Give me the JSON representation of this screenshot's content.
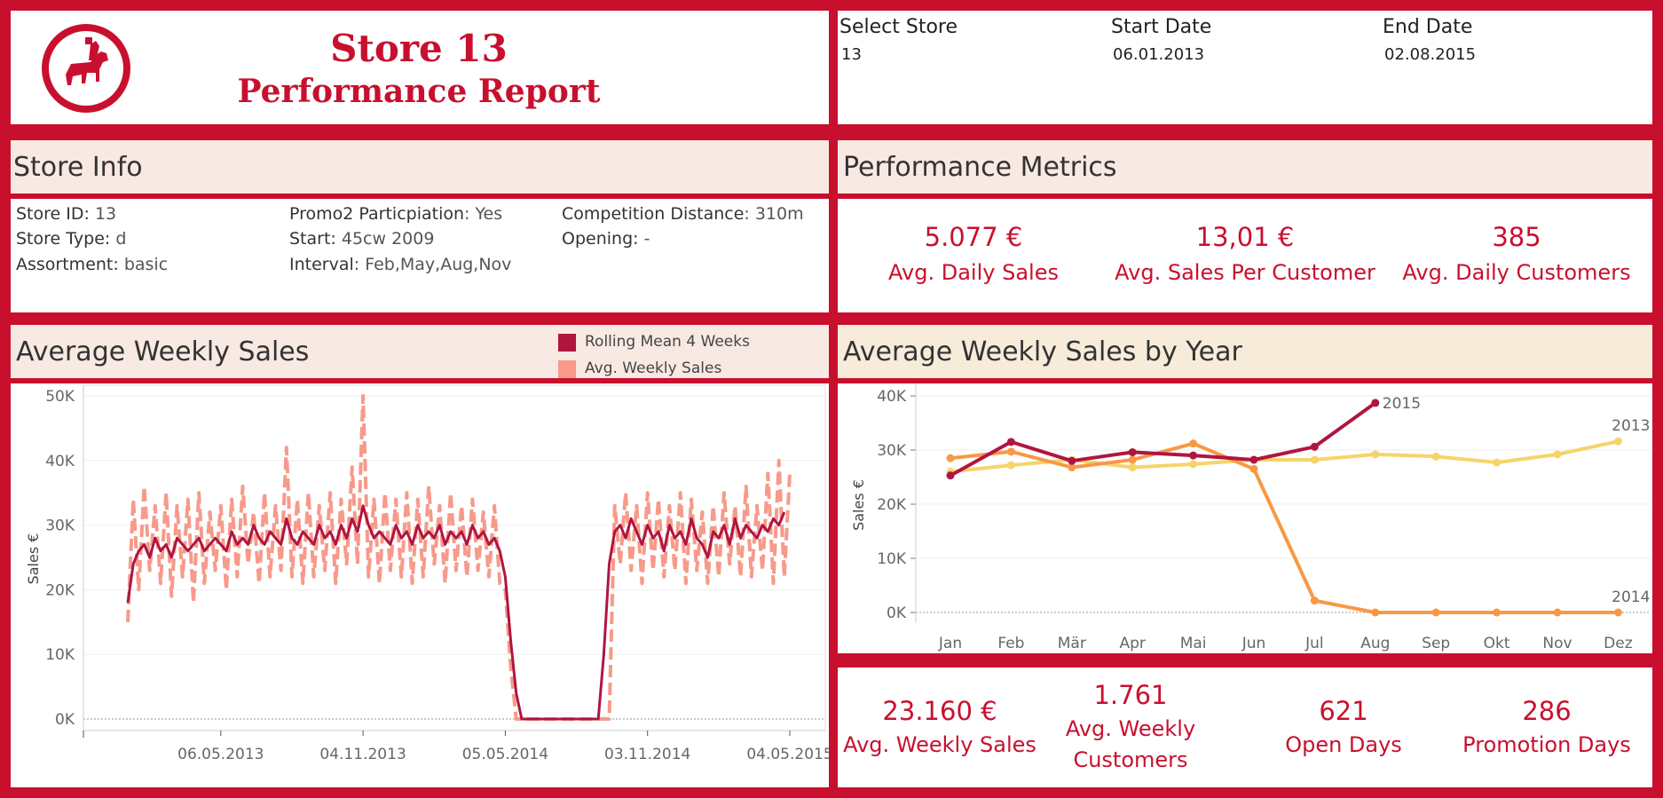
{
  "header": {
    "title_line1": "Store 13",
    "title_line2": "Performance Report",
    "logo": "rider-horse-logo"
  },
  "filters": {
    "store_label": "Select Store",
    "store_value": "13",
    "start_label": "Start Date",
    "start_value": "06.01.2013",
    "end_label": "End Date",
    "end_value": "02.08.2015"
  },
  "store_info": {
    "title": "Store Info",
    "store_id_label": "Store ID:",
    "store_id": "13",
    "store_type_label": "Store Type:",
    "store_type": "d",
    "assortment_label": "Assortment:",
    "assortment": "basic",
    "promo2_label": "Promo2 Particpiation",
    "promo2": ": Yes",
    "start_label": "Start:",
    "start": "45cw 2009",
    "interval_label": "Interval",
    "interval": ": Feb,May,Aug,Nov",
    "competition_label": "Competition Distance",
    "competition": ": 310m",
    "opening_label": "Opening:",
    "opening": "-"
  },
  "metrics": {
    "title": "Performance Metrics",
    "items": [
      {
        "value": "5.077 €",
        "label": "Avg. Daily Sales"
      },
      {
        "value": "13,01 €",
        "label": "Avg. Sales Per Customer"
      },
      {
        "value": "385",
        "label": "Avg. Daily Customers"
      }
    ]
  },
  "bottom_kpis": {
    "items": [
      {
        "value": "23.160 €",
        "label": "Avg. Weekly Sales"
      },
      {
        "value": "1.761",
        "label": "Avg. Weekly Customers"
      },
      {
        "value": "621",
        "label": "Open Days"
      },
      {
        "value": "286",
        "label": "Promotion Days"
      }
    ]
  },
  "colors": {
    "brand": "#c8102e",
    "rolling": "#b01540",
    "weekly": "#f79a8a",
    "y2013": "#f5d46a",
    "y2014": "#f89845",
    "y2015": "#b01540"
  },
  "chart_data": [
    {
      "type": "line",
      "title": "Average Weekly Sales",
      "ylabel": "Sales €",
      "xlabel": "",
      "ylim": [
        0,
        50000
      ],
      "yticks": [
        0,
        10000,
        20000,
        30000,
        40000,
        50000
      ],
      "ytick_labels": [
        "0K",
        "10K",
        "20K",
        "30K",
        "40K",
        "50K"
      ],
      "xtick_labels": [
        "06.05.2013",
        "04.11.2013",
        "05.05.2014",
        "03.11.2014",
        "04.05.2015"
      ],
      "xtick_positions_week": [
        17,
        43,
        69,
        95,
        121
      ],
      "legend": [
        "Rolling Mean 4 Weeks",
        "Avg. Weekly Sales"
      ],
      "legend_position": "top-right",
      "series": [
        {
          "name": "Avg. Weekly Sales",
          "style": "dashed",
          "values": [
            15000,
            34000,
            20000,
            36000,
            23000,
            33000,
            21000,
            35000,
            19000,
            33000,
            22000,
            34000,
            18000,
            35000,
            21000,
            32000,
            23000,
            33000,
            20000,
            34000,
            22000,
            36000,
            24000,
            32000,
            21000,
            35000,
            22000,
            33000,
            23000,
            42000,
            22000,
            34000,
            21000,
            35000,
            22000,
            33000,
            23000,
            35000,
            21000,
            34000,
            24000,
            39000,
            24000,
            50000,
            22000,
            34000,
            21000,
            35000,
            23000,
            34000,
            22000,
            35000,
            21000,
            34000,
            22000,
            36000,
            24000,
            33000,
            21000,
            35000,
            23000,
            33000,
            22000,
            34000,
            23000,
            32000,
            22000,
            33000,
            21000,
            20000,
            8000,
            0,
            0,
            0,
            0,
            0,
            0,
            0,
            0,
            0,
            0,
            0,
            0,
            0,
            0,
            0,
            0,
            0,
            0,
            33000,
            24000,
            35000,
            23000,
            33000,
            21000,
            35000,
            23000,
            34000,
            22000,
            33000,
            23000,
            35000,
            21000,
            34000,
            23000,
            32000,
            21000,
            33000,
            22000,
            35000,
            24000,
            33000,
            22000,
            36000,
            22000,
            33000,
            23000,
            38000,
            21000,
            40000,
            22000,
            38000
          ]
        },
        {
          "name": "Rolling Mean 4 Weeks",
          "style": "solid",
          "values": [
            18000,
            24000,
            26000,
            27000,
            25000,
            28000,
            26000,
            27000,
            25000,
            28000,
            27000,
            26000,
            27000,
            28000,
            26000,
            27000,
            28000,
            27000,
            26000,
            29000,
            27000,
            28000,
            27000,
            30000,
            28000,
            27000,
            29000,
            28000,
            27000,
            31000,
            28000,
            27000,
            29000,
            28000,
            27000,
            30000,
            28000,
            29000,
            27000,
            30000,
            28000,
            31000,
            29000,
            33000,
            30000,
            28000,
            29000,
            28000,
            27000,
            30000,
            28000,
            29000,
            27000,
            30000,
            28000,
            29000,
            28000,
            30000,
            27000,
            29000,
            28000,
            29000,
            27000,
            30000,
            28000,
            29000,
            27000,
            28000,
            26000,
            22000,
            12000,
            4000,
            0,
            0,
            0,
            0,
            0,
            0,
            0,
            0,
            0,
            0,
            0,
            0,
            0,
            0,
            0,
            10000,
            24000,
            29000,
            30000,
            28000,
            31000,
            29000,
            27000,
            30000,
            28000,
            29000,
            26000,
            30000,
            28000,
            29000,
            27000,
            31000,
            28000,
            27000,
            25000,
            29000,
            28000,
            30000,
            27000,
            31000,
            28000,
            30000,
            29000,
            28000,
            30000,
            29000,
            31000,
            30000,
            32000
          ]
        }
      ]
    },
    {
      "type": "line",
      "title": "Average Weekly Sales by Year",
      "ylabel": "Sales €",
      "ylim": [
        0,
        40000
      ],
      "yticks": [
        0,
        10000,
        20000,
        30000,
        40000
      ],
      "ytick_labels": [
        "0K",
        "10K",
        "20K",
        "30K",
        "40K"
      ],
      "categories": [
        "Jan",
        "Feb",
        "Mär",
        "Apr",
        "Mai",
        "Jun",
        "Jul",
        "Aug",
        "Sep",
        "Okt",
        "Nov",
        "Dez"
      ],
      "series": [
        {
          "name": "2013",
          "values": [
            26000,
            27200,
            28200,
            26800,
            27400,
            28200,
            28200,
            29200,
            28800,
            27700,
            29200,
            31600
          ]
        },
        {
          "name": "2014",
          "values": [
            28500,
            29700,
            26800,
            28200,
            31200,
            26500,
            2200,
            0,
            0,
            0,
            0,
            0
          ]
        },
        {
          "name": "2015",
          "values": [
            25300,
            31500,
            28000,
            29600,
            29000,
            28200,
            30600,
            38700
          ]
        }
      ]
    }
  ]
}
